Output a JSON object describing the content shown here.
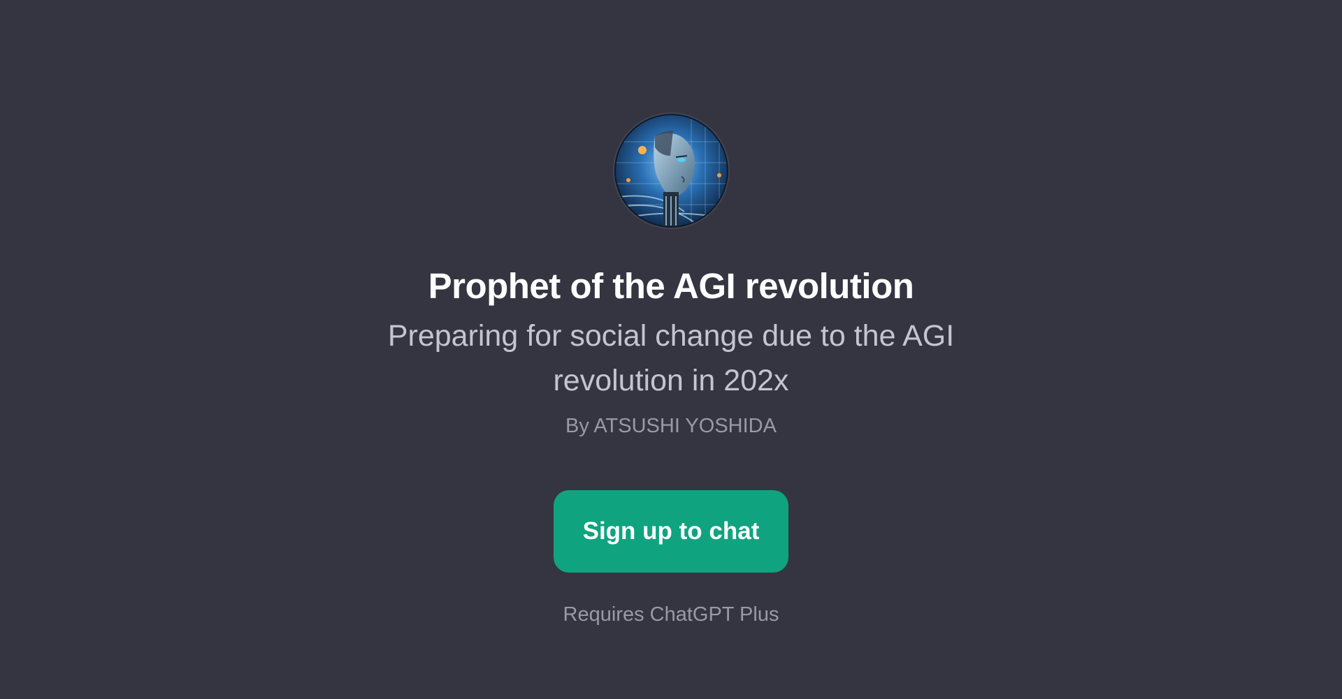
{
  "gpt": {
    "avatar_icon": "robot-head-portrait-icon",
    "title": "Prophet of the AGI revolution",
    "description": "Preparing for social change due to the AGI revolution in 202x",
    "author": "By ATSUSHI YOSHIDA"
  },
  "actions": {
    "signup_label": "Sign up to chat"
  },
  "footer": {
    "requirement": "Requires ChatGPT Plus"
  },
  "colors": {
    "background": "#343541",
    "accent": "#10a37f",
    "title": "#ffffff",
    "subtitle": "#c5c5d2",
    "muted": "#9a9aa6"
  }
}
